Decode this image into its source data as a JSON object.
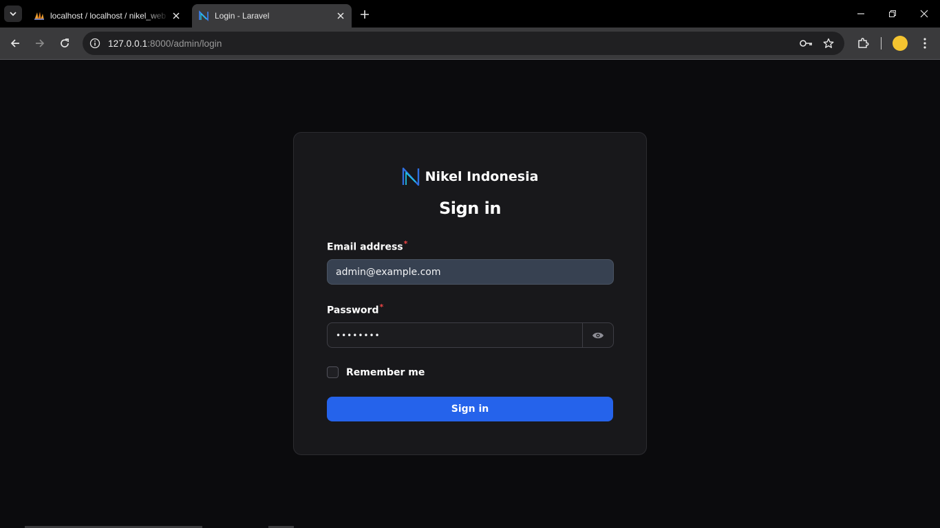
{
  "browser": {
    "tabs": [
      {
        "title": "localhost / localhost / nikel_web",
        "active": false,
        "icon": "phpmyadmin-icon"
      },
      {
        "title": "Login - Laravel",
        "active": true,
        "icon": "nikel-logo-icon"
      }
    ],
    "url_host": "127.0.0.1",
    "url_rest": ":8000/admin/login",
    "accent": "#f4c430"
  },
  "login": {
    "brand_name": "Nikel Indonesia",
    "heading": "Sign in",
    "email_label": "Email address",
    "email_value": "admin@example.com",
    "password_label": "Password",
    "password_value": "••••••••",
    "required_mark": "*",
    "remember_label": "Remember me",
    "submit_label": "Sign in",
    "button_color": "#2563eb"
  }
}
